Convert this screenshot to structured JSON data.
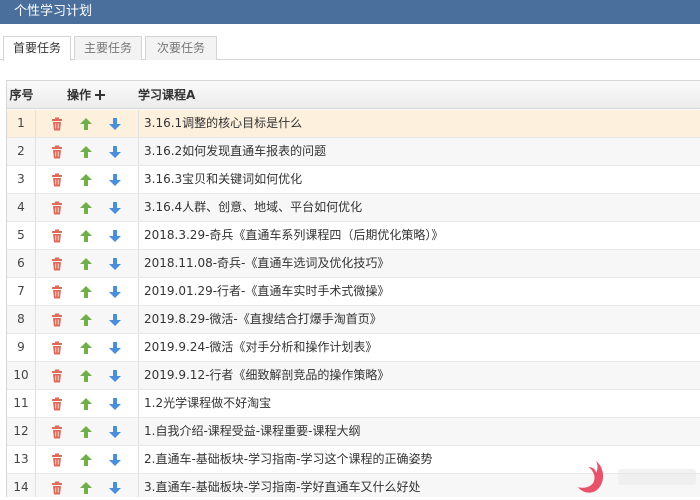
{
  "window": {
    "title": "个性学习计划"
  },
  "tabs": [
    {
      "label": "首要任务",
      "active": true
    },
    {
      "label": "主要任务",
      "active": false
    },
    {
      "label": "次要任务",
      "active": false
    }
  ],
  "table": {
    "headers": {
      "no": "序号",
      "ops": "操作",
      "course": "学习课程A"
    },
    "rows": [
      {
        "no": "1",
        "course": "3.16.1调整的核心目标是什么"
      },
      {
        "no": "2",
        "course": "3.16.2如何发现直通车报表的问题"
      },
      {
        "no": "3",
        "course": "3.16.3宝贝和关键词如何优化"
      },
      {
        "no": "4",
        "course": "3.16.4人群、创意、地域、平台如何优化"
      },
      {
        "no": "5",
        "course": "2018.3.29-奇兵《直通车系列课程四（后期优化策略）》"
      },
      {
        "no": "6",
        "course": "2018.11.08-奇兵-《直通车选词及优化技巧》"
      },
      {
        "no": "7",
        "course": "2019.01.29-行者-《直通车实时手术式微操》"
      },
      {
        "no": "8",
        "course": "2019.8.29-微活-《直搜结合打爆手淘首页》"
      },
      {
        "no": "9",
        "course": "2019.9.24-微活《对手分析和操作计划表》"
      },
      {
        "no": "10",
        "course": "2019.9.12-行者《细致解剖竞品的操作策略》"
      },
      {
        "no": "11",
        "course": "1.2光学课程做不好淘宝"
      },
      {
        "no": "12",
        "course": "1.自我介绍-课程受益-课程重要-课程大纲"
      },
      {
        "no": "13",
        "course": "2.直通车-基础板块-学习指南-学习这个课程的正确姿势"
      },
      {
        "no": "14",
        "course": "3.直通车-基础板块-学习指南-学好直通车又什么好处"
      }
    ],
    "selected_row": 1
  },
  "colors": {
    "title_bg": "#4a6f9d",
    "selected_row": "#fdf0dc",
    "delete_icon": "#e06a5a",
    "up_icon": "#6fb04a",
    "down_icon": "#4a90d9"
  },
  "icons": {
    "delete": "trash-icon",
    "up": "arrow-up-icon",
    "down": "arrow-down-icon",
    "add": "plus-icon"
  }
}
